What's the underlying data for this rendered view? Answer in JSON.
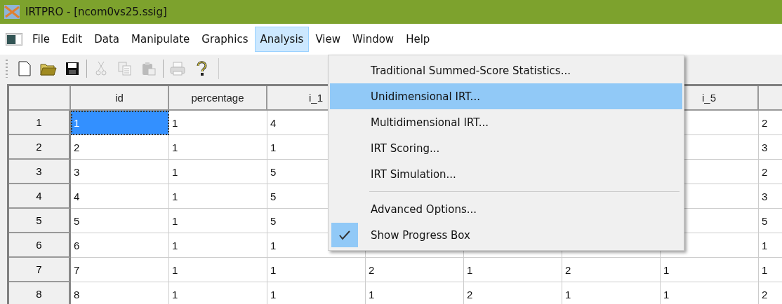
{
  "window": {
    "title": "IRTPRO - [ncom0vs25.ssig]"
  },
  "menu_bar": [
    {
      "label": "File",
      "selected": false
    },
    {
      "label": "Edit",
      "selected": false
    },
    {
      "label": "Data",
      "selected": false
    },
    {
      "label": "Manipulate",
      "selected": false
    },
    {
      "label": "Graphics",
      "selected": false
    },
    {
      "label": "Analysis",
      "selected": true
    },
    {
      "label": "View",
      "selected": false
    },
    {
      "label": "Window",
      "selected": false
    },
    {
      "label": "Help",
      "selected": false
    }
  ],
  "toolbar": [
    {
      "kind": "new",
      "disabled": false
    },
    {
      "kind": "open",
      "disabled": false
    },
    {
      "kind": "save",
      "disabled": false
    },
    {
      "kind": "sep"
    },
    {
      "kind": "cut",
      "disabled": true
    },
    {
      "kind": "copy",
      "disabled": true
    },
    {
      "kind": "paste",
      "disabled": true
    },
    {
      "kind": "sep"
    },
    {
      "kind": "print",
      "disabled": true
    },
    {
      "kind": "help",
      "disabled": false
    }
  ],
  "table": {
    "columns": [
      {
        "label": "id"
      },
      {
        "label": "percentage"
      },
      {
        "label": "i_1"
      },
      null,
      null,
      null,
      {
        "label": "i_5"
      },
      {}
    ],
    "rows": [
      {
        "number": "1",
        "cells": [
          {
            "text": "1",
            "selected": true
          },
          {
            "text": "1",
            "selected": false
          },
          {
            "text": "4",
            "selected": false
          },
          null,
          null,
          null,
          {},
          {
            "text": "2",
            "selected": false
          }
        ]
      },
      {
        "number": "2",
        "cells": [
          {
            "text": "2",
            "selected": false
          },
          {
            "text": "1",
            "selected": false
          },
          {
            "text": "1",
            "selected": false
          },
          null,
          null,
          null,
          {},
          {
            "text": "3",
            "selected": false
          }
        ]
      },
      {
        "number": "3",
        "cells": [
          {
            "text": "3",
            "selected": false
          },
          {
            "text": "1",
            "selected": false
          },
          {
            "text": "5",
            "selected": false
          },
          null,
          null,
          null,
          {},
          {
            "text": "2",
            "selected": false
          }
        ]
      },
      {
        "number": "4",
        "cells": [
          {
            "text": "4",
            "selected": false
          },
          {
            "text": "1",
            "selected": false
          },
          {
            "text": "5",
            "selected": false
          },
          null,
          null,
          null,
          {},
          {
            "text": "3",
            "selected": false
          }
        ]
      },
      {
        "number": "5",
        "cells": [
          {
            "text": "5",
            "selected": false
          },
          {
            "text": "1",
            "selected": false
          },
          {
            "text": "5",
            "selected": false
          },
          null,
          null,
          null,
          {},
          {
            "text": "5",
            "selected": false
          }
        ]
      },
      {
        "number": "6",
        "cells": [
          {
            "text": "6",
            "selected": false
          },
          {
            "text": "1",
            "selected": false
          },
          {
            "text": "1",
            "selected": false
          },
          {},
          {},
          {},
          {},
          {
            "text": "1",
            "selected": false
          }
        ]
      },
      {
        "number": "7",
        "cells": [
          {
            "text": "7",
            "selected": false
          },
          {
            "text": "1",
            "selected": false
          },
          {
            "text": "1",
            "selected": false
          },
          {
            "text": "2",
            "selected": false
          },
          {
            "text": "1",
            "selected": false
          },
          {
            "text": "2",
            "selected": false
          },
          {
            "text": "1",
            "selected": false
          },
          {
            "text": "1",
            "selected": false
          }
        ]
      },
      {
        "number": "8",
        "cells": [
          {
            "text": "8",
            "selected": false
          },
          {
            "text": "1",
            "selected": false
          },
          {
            "text": "1",
            "selected": false
          },
          {
            "text": "1",
            "selected": false
          },
          {
            "text": "2",
            "selected": false
          },
          {
            "text": "1",
            "selected": false
          },
          {
            "text": "1",
            "selected": false
          },
          {
            "text": "2",
            "selected": false
          }
        ]
      }
    ]
  },
  "analysis_menu": [
    {
      "kind": "item",
      "label": "Traditional Summed-Score Statistics...",
      "selected": false,
      "checked": false
    },
    {
      "kind": "item",
      "label": "Unidimensional IRT...",
      "selected": true,
      "checked": false
    },
    {
      "kind": "item",
      "label": "Multidimensional IRT...",
      "selected": false,
      "checked": false
    },
    {
      "kind": "item",
      "label": "IRT Scoring...",
      "selected": false,
      "checked": false
    },
    {
      "kind": "item",
      "label": "IRT Simulation...",
      "selected": false,
      "checked": false
    },
    {
      "kind": "separator"
    },
    {
      "kind": "item",
      "label": "Advanced Options...",
      "selected": false,
      "checked": false
    },
    {
      "kind": "item",
      "label": "Show Progress Box",
      "selected": false,
      "checked": true
    }
  ]
}
